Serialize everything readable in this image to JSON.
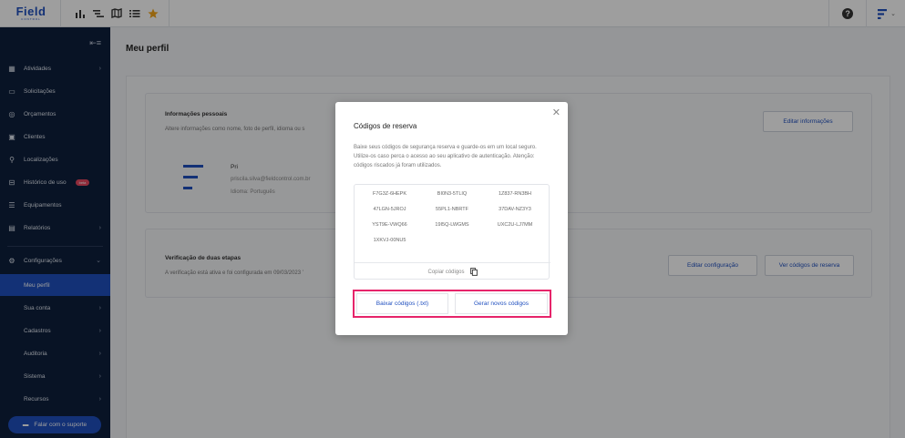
{
  "app": {
    "logo": "Field",
    "logo_sub": "CONTROL"
  },
  "topbar": {
    "help": "?",
    "accent": "#1f4fbf"
  },
  "sidebar": {
    "items": [
      {
        "label": "Atividades",
        "icon": "calendar-icon",
        "has_arrow": true
      },
      {
        "label": "Solicitações",
        "icon": "inbox-icon"
      },
      {
        "label": "Orçamentos",
        "icon": "money-icon"
      },
      {
        "label": "Clientes",
        "icon": "contact-icon"
      },
      {
        "label": "Localizações",
        "icon": "pin-icon"
      },
      {
        "label": "Histórico de uso",
        "icon": "car-icon",
        "badge": "beta"
      },
      {
        "label": "Equipamentos",
        "icon": "server-icon"
      },
      {
        "label": "Relatórios",
        "icon": "report-icon",
        "has_arrow": true
      }
    ],
    "config": {
      "label": "Configurações",
      "icon": "gear-icon"
    },
    "sub_items": [
      {
        "label": "Meu perfil",
        "active": true
      },
      {
        "label": "Sua conta",
        "has_arrow": true
      },
      {
        "label": "Cadastros",
        "has_arrow": true
      },
      {
        "label": "Auditoria",
        "has_arrow": true
      },
      {
        "label": "Sistema",
        "has_arrow": true
      },
      {
        "label": "Recursos",
        "has_arrow": true
      }
    ],
    "support_label": "Falar com o suporte"
  },
  "page": {
    "title": "Meu perfil",
    "personal": {
      "heading": "Informações pessoais",
      "sub": "Altere informações como nome, foto de perfil, idioma ou s",
      "edit_label": "Editar informações",
      "name": "Pri",
      "email": "priscila.silva@fieldcontrol.com.br",
      "language": "Idioma: Português"
    },
    "twofa": {
      "heading": "Verificação de duas etapas",
      "sub": "A verificação está ativa e foi configurada em 09/03/2023 ’",
      "edit_label": "Editar configuração",
      "codes_label": "Ver códigos de reserva"
    }
  },
  "modal": {
    "title": "Códigos de reserva",
    "description": "Baixe seus códigos de segurança reserva e guarde-os em um local seguro. Utilize-os caso perca o acesso ao seu aplicativo de autenticação. Atenção: códigos riscados já foram utilizados.",
    "codes": [
      "F7G3Z-6HEPK",
      "BI0N3-5TLIQ",
      "1Z837-RN3BH",
      "47LGN-5JROJ",
      "55PL1-NBRTF",
      "37DAV-NZ3Y3",
      "YST9E-VWQ66",
      "19I5Q-LWGMS",
      "UXC2U-LJ7MM",
      "1XKVJ-00NU5"
    ],
    "copy_label": "Copiar códigos",
    "download_label": "Baixar códigos (.txt)",
    "generate_label": "Gerar novos códigos",
    "highlight_color": "#e6246a"
  }
}
